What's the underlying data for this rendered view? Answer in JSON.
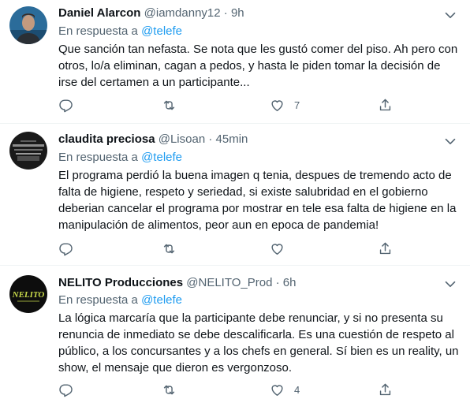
{
  "tweets": [
    {
      "name": "Daniel Alarcon",
      "handle": "@iamdanny12",
      "time": "9h",
      "reply_prefix": "En respuesta a",
      "reply_to": "@telefe",
      "text": "Que sanción tan nefasta. Se nota que les gustó comer del piso. Ah pero con otros, lo/a eliminan, cagan a pedos, y hasta le piden tomar la decisión de irse del certamen a un participante...",
      "likes": "7"
    },
    {
      "name": "claudita preciosa",
      "handle": "@Lisoan",
      "time": "45min",
      "reply_prefix": "En respuesta a",
      "reply_to": "@telefe",
      "text": "El programa perdió la buena imagen q tenia, despues de tremendo acto de falta de higiene, respeto y seriedad, si existe salubridad en el gobierno deberian cancelar el programa por mostrar en tele esa falta de higiene en la manipulación de alimentos, peor aun en epoca de pandemia!",
      "likes": ""
    },
    {
      "name": "NELITO Producciones",
      "handle": "@NELITO_Prod",
      "time": "6h",
      "reply_prefix": "En respuesta a",
      "reply_to": "@telefe",
      "text": "La lógica marcaría que la participante debe renunciar, y si no presenta su renuncia de inmediato se debe descalificarla. Es una cuestión de respeto al público, a los concursantes y a los chefs en general. Sí bien es un reality, un show, el mensaje que dieron es vergonzoso.",
      "likes": "4"
    }
  ],
  "avatar_logo_text": "NELITO",
  "colors": {
    "accent": "#1d9bf0",
    "secondary": "#536471",
    "divider": "#eff3f4"
  }
}
